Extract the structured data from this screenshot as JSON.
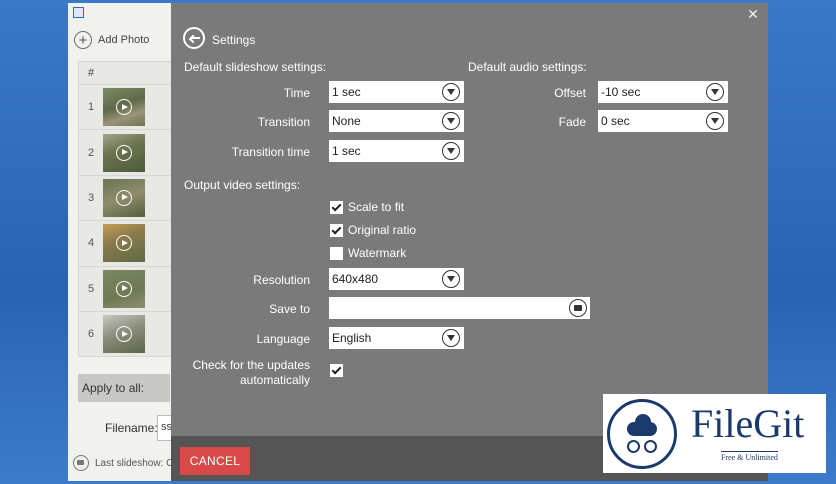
{
  "app": {
    "toolbar": {
      "add_photo_label": "Add Photo"
    },
    "table": {
      "hash_header": "#",
      "rows": [
        {
          "num": "1"
        },
        {
          "num": "2"
        },
        {
          "num": "3"
        },
        {
          "num": "4"
        },
        {
          "num": "5"
        },
        {
          "num": "6"
        }
      ]
    },
    "apply_label": "Apply to all:",
    "filename_label": "Filename:",
    "filename_value": "ss",
    "last_slideshow_label": "Last slideshow: C"
  },
  "dialog": {
    "title": "Settings",
    "slideshow_section": "Default slideshow settings:",
    "audio_section": "Default audio settings:",
    "time": {
      "label": "Time",
      "value": "1 sec"
    },
    "transition": {
      "label": "Transition",
      "value": "None"
    },
    "transition_time": {
      "label": "Transition time",
      "value": "1 sec"
    },
    "offset": {
      "label": "Offset",
      "value": "-10 sec"
    },
    "fade": {
      "label": "Fade",
      "value": "0 sec"
    },
    "output_section": "Output video settings:",
    "scale_to_fit": {
      "label": "Scale to fit",
      "checked": true
    },
    "original_ratio": {
      "label": "Original ratio",
      "checked": true
    },
    "watermark": {
      "label": "Watermark",
      "checked": false
    },
    "resolution": {
      "label": "Resolution",
      "value": "640x480"
    },
    "save_to": {
      "label": "Save to",
      "value": ""
    },
    "language": {
      "label": "Language",
      "value": "English"
    },
    "updates": {
      "label_line1": "Check for the updates",
      "label_line2": "automatically",
      "checked": true
    },
    "cancel_label": "CANCEL"
  },
  "watermark_logo": {
    "name": "FileGit",
    "tagline": "Free & Unlimited"
  },
  "colors": {
    "dialog_bg": "#7a7a7a",
    "footer_bg": "#555555",
    "cancel": "#d84a4a",
    "brand": "#1b3a6b"
  }
}
